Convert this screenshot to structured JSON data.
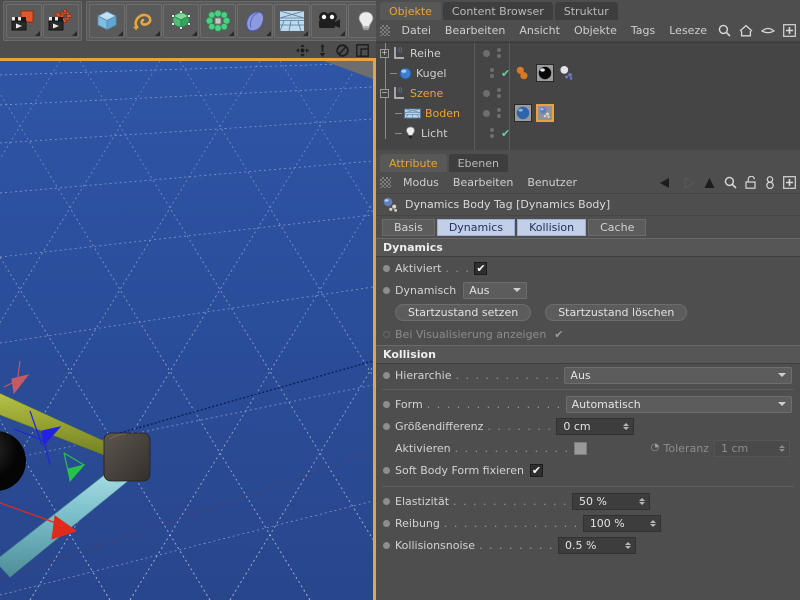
{
  "toolbar": {
    "groups": [
      {
        "name": "render-group",
        "buttons": [
          {
            "icon": "render-view-icon",
            "label": "Ansicht rendern"
          },
          {
            "icon": "render-settings-icon",
            "label": "Rendervoreinstellungen"
          }
        ]
      },
      {
        "name": "primitives-group",
        "buttons": [
          {
            "icon": "cube-primitive-icon",
            "label": "Grundobjekt"
          },
          {
            "icon": "spline-icon",
            "label": "Spline"
          },
          {
            "icon": "nurbs-icon",
            "label": "NURBS"
          },
          {
            "icon": "array-icon",
            "label": "Modeling-Objekt"
          },
          {
            "icon": "deformer-icon",
            "label": "Deformer"
          },
          {
            "icon": "floor-scene-icon",
            "label": "Szene"
          },
          {
            "icon": "camera-icon",
            "label": "Kamera"
          },
          {
            "icon": "light-icon",
            "label": "Licht"
          }
        ]
      }
    ],
    "axis_locks": [
      {
        "icon": "move-axis-icon"
      },
      {
        "icon": "scale-axis-icon"
      },
      {
        "icon": "rotate-axis-icon"
      },
      {
        "icon": "layout-icon"
      }
    ]
  },
  "viewport": {
    "name": "perspective-viewport",
    "background_color": "#2d52a0",
    "border_color": "#e8a33d",
    "grid_color": "#7f92c4",
    "objects": [
      {
        "name": "olive-tube",
        "color": "#9aa633"
      },
      {
        "name": "cyan-tube",
        "color": "#7fc2cc"
      },
      {
        "name": "dark-cube",
        "color": "#4a443f"
      },
      {
        "name": "dark-sphere",
        "color": "#141414"
      }
    ],
    "axis_handles": [
      {
        "name": "x-axis-handle",
        "color": "#e02b1c"
      },
      {
        "name": "y-axis-handle",
        "color": "#25c24a"
      },
      {
        "name": "z-axis-handle",
        "color": "#2222e0"
      },
      {
        "name": "secondary-axis-handle",
        "color": "#c65a64"
      }
    ]
  },
  "object_manager": {
    "tabs": [
      {
        "label": "Objekte",
        "active": true
      },
      {
        "label": "Content Browser",
        "active": false
      },
      {
        "label": "Struktur",
        "active": false
      }
    ],
    "menu": [
      "Datei",
      "Bearbeiten",
      "Ansicht",
      "Objekte",
      "Tags",
      "Leseze"
    ],
    "menu_icons": [
      "search-icon",
      "home-icon",
      "eye-icon",
      "plus-box-icon"
    ],
    "rows": [
      {
        "label": "Reihe",
        "icon": "null-object-icon",
        "indent": 0,
        "expander": "+",
        "selected": false,
        "visible_dots": true,
        "check": false
      },
      {
        "label": "Kugel",
        "icon": "sphere-object-icon",
        "indent": 1,
        "expander": "",
        "selected": false,
        "visible_dots": true,
        "check": true,
        "tags": [
          "dynamics-tag-orange-icon",
          "material-tag-black-icon",
          "dynamics-body-tag-icon"
        ]
      },
      {
        "label": "Szene",
        "icon": "null-object-icon",
        "indent": 0,
        "expander": "-",
        "selected": true,
        "visible_dots": true,
        "check": false
      },
      {
        "label": "Boden",
        "icon": "floor-object-icon",
        "indent": 1,
        "expander": "",
        "selected": true,
        "visible_dots": true,
        "check": false,
        "tags": [
          "material-tag-blue-icon",
          "dynamics-body-tag-selected-icon"
        ]
      },
      {
        "label": "Licht",
        "icon": "light-object-icon",
        "indent": 1,
        "expander": "",
        "selected": false,
        "visible_dots": true,
        "check": true
      }
    ]
  },
  "attribute_manager": {
    "tabs": [
      {
        "label": "Attribute",
        "active": true
      },
      {
        "label": "Ebenen",
        "active": false
      }
    ],
    "menu": [
      "Modus",
      "Bearbeiten",
      "Benutzer"
    ],
    "nav_icons": [
      "back-arrow-icon",
      "forward-arrow-icon",
      "up-arrow-icon",
      "search-icon",
      "unlock-icon",
      "user-icon",
      "plus-box-icon"
    ],
    "object_title": "Dynamics Body Tag [Dynamics Body]",
    "object_icon": "dynamics-body-tag-icon",
    "param_tabs": [
      {
        "label": "Basis",
        "active": false
      },
      {
        "label": "Dynamics",
        "active": true
      },
      {
        "label": "Kollision",
        "active": true
      },
      {
        "label": "Cache",
        "active": false
      }
    ],
    "sections": [
      {
        "name": "dynamics-section",
        "title": "Dynamics",
        "rows": [
          {
            "type": "checkbox",
            "label": "Aktiviert",
            "dots": ". . .",
            "checked": true,
            "enabled": true
          },
          {
            "type": "dropdown",
            "label": "Dynamisch",
            "dots": "",
            "value": "Aus",
            "enabled": true
          },
          {
            "type": "buttons",
            "buttons": [
              "Startzustand setzen",
              "Startzustand löschen"
            ]
          },
          {
            "type": "checkbox",
            "label": "Bei Visualisierung anzeigen",
            "dots": "",
            "checked": true,
            "enabled": false
          }
        ]
      },
      {
        "name": "collision-section",
        "title": "Kollision",
        "rows": [
          {
            "type": "dropdown-wide",
            "label": "Hierarchie",
            "dots": ". . . . . . . . . . .",
            "value": "Aus",
            "enabled": true
          },
          {
            "type": "divider"
          },
          {
            "type": "dropdown-wide",
            "label": "Form",
            "dots": ". . . . . . . . . . . . . .",
            "value": "Automatisch",
            "enabled": true
          },
          {
            "type": "number",
            "label": "Größendifferenz",
            "dots": ". . . . . . .",
            "value": "0 cm",
            "enabled": true
          },
          {
            "type": "checkbox-tolerance",
            "label": "Aktivieren",
            "dots": ". . . . . . . . . . . .",
            "checked": false,
            "sub_label": "Toleranz",
            "sub_value": "1 cm",
            "sub_enabled": false
          },
          {
            "type": "checkbox",
            "label": "Soft Body Form fixieren",
            "dots": "",
            "checked": true,
            "enabled": true
          },
          {
            "type": "divider"
          },
          {
            "type": "number",
            "label": "Elastizität",
            "dots": ". . . . . . . . . . . .",
            "value": "50 %",
            "enabled": true
          },
          {
            "type": "number",
            "label": "Reibung",
            "dots": ". . . . . . . . . . . . . .",
            "value": "100 %",
            "enabled": true
          },
          {
            "type": "number",
            "label": "Kollisionsnoise",
            "dots": ". . . . . . . .",
            "value": "0.5 %",
            "enabled": true
          }
        ]
      }
    ]
  },
  "colors": {
    "panel_bg": "#4e4e4e",
    "section_bg": "#565656",
    "accent_orange": "#f0a32e",
    "tab_active_blue": "#c3cfe9",
    "check_green": "#5fd39a",
    "viewport_blue": "#2d52a0"
  }
}
